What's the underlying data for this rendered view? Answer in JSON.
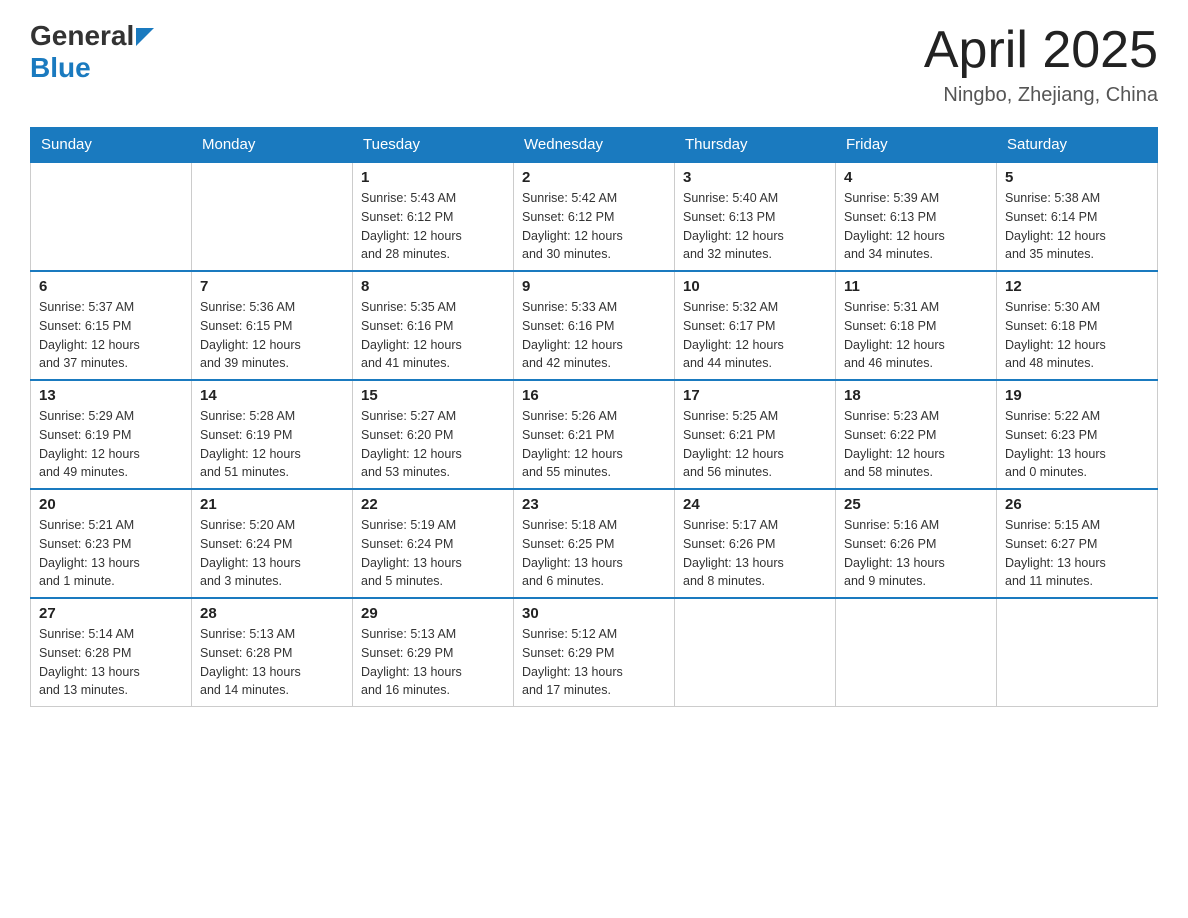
{
  "header": {
    "logo_general": "General",
    "logo_blue": "Blue",
    "month_title": "April 2025",
    "location": "Ningbo, Zhejiang, China"
  },
  "days_of_week": [
    "Sunday",
    "Monday",
    "Tuesday",
    "Wednesday",
    "Thursday",
    "Friday",
    "Saturday"
  ],
  "weeks": [
    [
      {
        "day": "",
        "info": ""
      },
      {
        "day": "",
        "info": ""
      },
      {
        "day": "1",
        "info": "Sunrise: 5:43 AM\nSunset: 6:12 PM\nDaylight: 12 hours\nand 28 minutes."
      },
      {
        "day": "2",
        "info": "Sunrise: 5:42 AM\nSunset: 6:12 PM\nDaylight: 12 hours\nand 30 minutes."
      },
      {
        "day": "3",
        "info": "Sunrise: 5:40 AM\nSunset: 6:13 PM\nDaylight: 12 hours\nand 32 minutes."
      },
      {
        "day": "4",
        "info": "Sunrise: 5:39 AM\nSunset: 6:13 PM\nDaylight: 12 hours\nand 34 minutes."
      },
      {
        "day": "5",
        "info": "Sunrise: 5:38 AM\nSunset: 6:14 PM\nDaylight: 12 hours\nand 35 minutes."
      }
    ],
    [
      {
        "day": "6",
        "info": "Sunrise: 5:37 AM\nSunset: 6:15 PM\nDaylight: 12 hours\nand 37 minutes."
      },
      {
        "day": "7",
        "info": "Sunrise: 5:36 AM\nSunset: 6:15 PM\nDaylight: 12 hours\nand 39 minutes."
      },
      {
        "day": "8",
        "info": "Sunrise: 5:35 AM\nSunset: 6:16 PM\nDaylight: 12 hours\nand 41 minutes."
      },
      {
        "day": "9",
        "info": "Sunrise: 5:33 AM\nSunset: 6:16 PM\nDaylight: 12 hours\nand 42 minutes."
      },
      {
        "day": "10",
        "info": "Sunrise: 5:32 AM\nSunset: 6:17 PM\nDaylight: 12 hours\nand 44 minutes."
      },
      {
        "day": "11",
        "info": "Sunrise: 5:31 AM\nSunset: 6:18 PM\nDaylight: 12 hours\nand 46 minutes."
      },
      {
        "day": "12",
        "info": "Sunrise: 5:30 AM\nSunset: 6:18 PM\nDaylight: 12 hours\nand 48 minutes."
      }
    ],
    [
      {
        "day": "13",
        "info": "Sunrise: 5:29 AM\nSunset: 6:19 PM\nDaylight: 12 hours\nand 49 minutes."
      },
      {
        "day": "14",
        "info": "Sunrise: 5:28 AM\nSunset: 6:19 PM\nDaylight: 12 hours\nand 51 minutes."
      },
      {
        "day": "15",
        "info": "Sunrise: 5:27 AM\nSunset: 6:20 PM\nDaylight: 12 hours\nand 53 minutes."
      },
      {
        "day": "16",
        "info": "Sunrise: 5:26 AM\nSunset: 6:21 PM\nDaylight: 12 hours\nand 55 minutes."
      },
      {
        "day": "17",
        "info": "Sunrise: 5:25 AM\nSunset: 6:21 PM\nDaylight: 12 hours\nand 56 minutes."
      },
      {
        "day": "18",
        "info": "Sunrise: 5:23 AM\nSunset: 6:22 PM\nDaylight: 12 hours\nand 58 minutes."
      },
      {
        "day": "19",
        "info": "Sunrise: 5:22 AM\nSunset: 6:23 PM\nDaylight: 13 hours\nand 0 minutes."
      }
    ],
    [
      {
        "day": "20",
        "info": "Sunrise: 5:21 AM\nSunset: 6:23 PM\nDaylight: 13 hours\nand 1 minute."
      },
      {
        "day": "21",
        "info": "Sunrise: 5:20 AM\nSunset: 6:24 PM\nDaylight: 13 hours\nand 3 minutes."
      },
      {
        "day": "22",
        "info": "Sunrise: 5:19 AM\nSunset: 6:24 PM\nDaylight: 13 hours\nand 5 minutes."
      },
      {
        "day": "23",
        "info": "Sunrise: 5:18 AM\nSunset: 6:25 PM\nDaylight: 13 hours\nand 6 minutes."
      },
      {
        "day": "24",
        "info": "Sunrise: 5:17 AM\nSunset: 6:26 PM\nDaylight: 13 hours\nand 8 minutes."
      },
      {
        "day": "25",
        "info": "Sunrise: 5:16 AM\nSunset: 6:26 PM\nDaylight: 13 hours\nand 9 minutes."
      },
      {
        "day": "26",
        "info": "Sunrise: 5:15 AM\nSunset: 6:27 PM\nDaylight: 13 hours\nand 11 minutes."
      }
    ],
    [
      {
        "day": "27",
        "info": "Sunrise: 5:14 AM\nSunset: 6:28 PM\nDaylight: 13 hours\nand 13 minutes."
      },
      {
        "day": "28",
        "info": "Sunrise: 5:13 AM\nSunset: 6:28 PM\nDaylight: 13 hours\nand 14 minutes."
      },
      {
        "day": "29",
        "info": "Sunrise: 5:13 AM\nSunset: 6:29 PM\nDaylight: 13 hours\nand 16 minutes."
      },
      {
        "day": "30",
        "info": "Sunrise: 5:12 AM\nSunset: 6:29 PM\nDaylight: 13 hours\nand 17 minutes."
      },
      {
        "day": "",
        "info": ""
      },
      {
        "day": "",
        "info": ""
      },
      {
        "day": "",
        "info": ""
      }
    ]
  ]
}
